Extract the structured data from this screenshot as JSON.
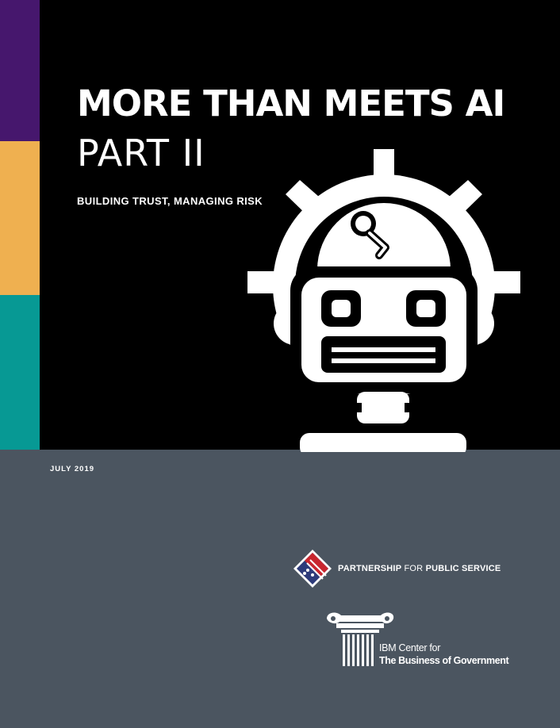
{
  "cover": {
    "title": "MORE THAN MEETS AI",
    "part": "PART II",
    "subtitle": "BUILDING TRUST, MANAGING RISK",
    "date": "JULY 2019",
    "colors": {
      "purple": "#46176d",
      "orange": "#efb050",
      "teal": "#079994",
      "black": "#000000",
      "slate": "#4b5560"
    }
  },
  "logos": {
    "partnership": {
      "bold1": "PARTNERSHIP",
      "light": " FOR ",
      "bold2": "PUBLIC SERVICE"
    },
    "ibm": {
      "line1": "IBM Center for",
      "line2": "The Business of Government"
    }
  },
  "icons": {
    "robot": "robot-gear-icon",
    "partnership": "flag-diamond-icon",
    "ibm": "column-capital-icon"
  }
}
